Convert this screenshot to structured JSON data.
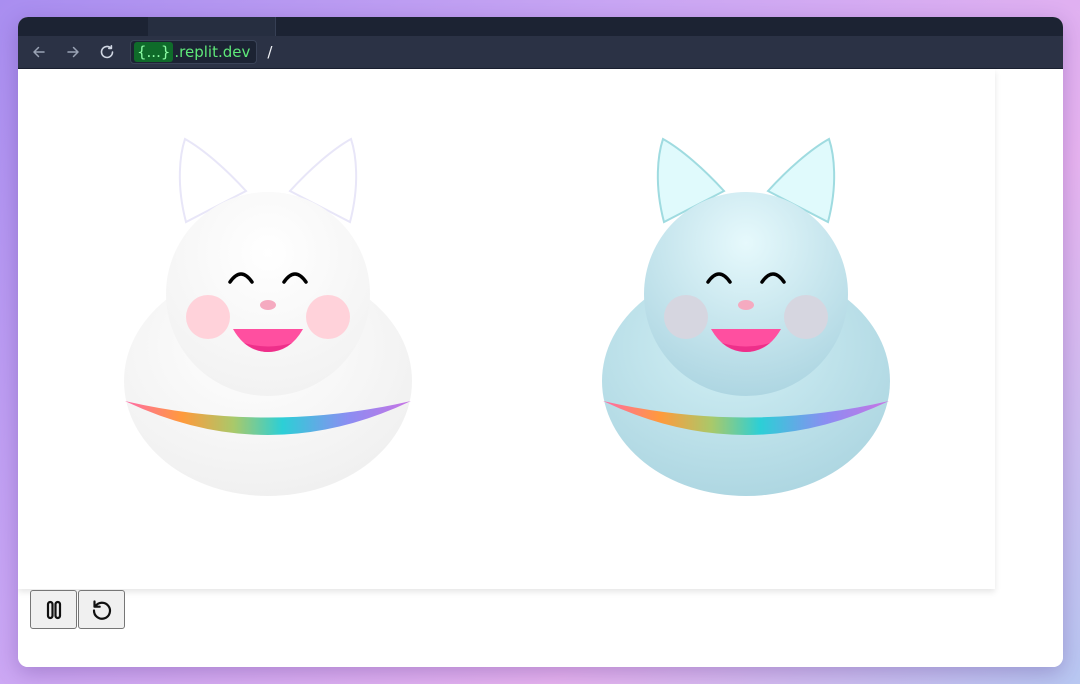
{
  "browser": {
    "url_badge": "{...}",
    "url_host": ".replit.dev",
    "url_path": "/"
  },
  "scene": {
    "characters": [
      {
        "name": "white-cat",
        "body_color": "#f6f6f6",
        "ear_color": "#ffffff"
      },
      {
        "name": "blue-cat",
        "body_color": "#b4dde6",
        "ear_color": "#e0fafc"
      }
    ],
    "colors": {
      "eyes": "#000000",
      "mouth": "#ff4fa0",
      "nose": "#f5aac0",
      "cheeks": "#ffcfd8"
    }
  },
  "controls": {
    "pause_icon": "pause-icon",
    "restart_icon": "restart-icon"
  }
}
